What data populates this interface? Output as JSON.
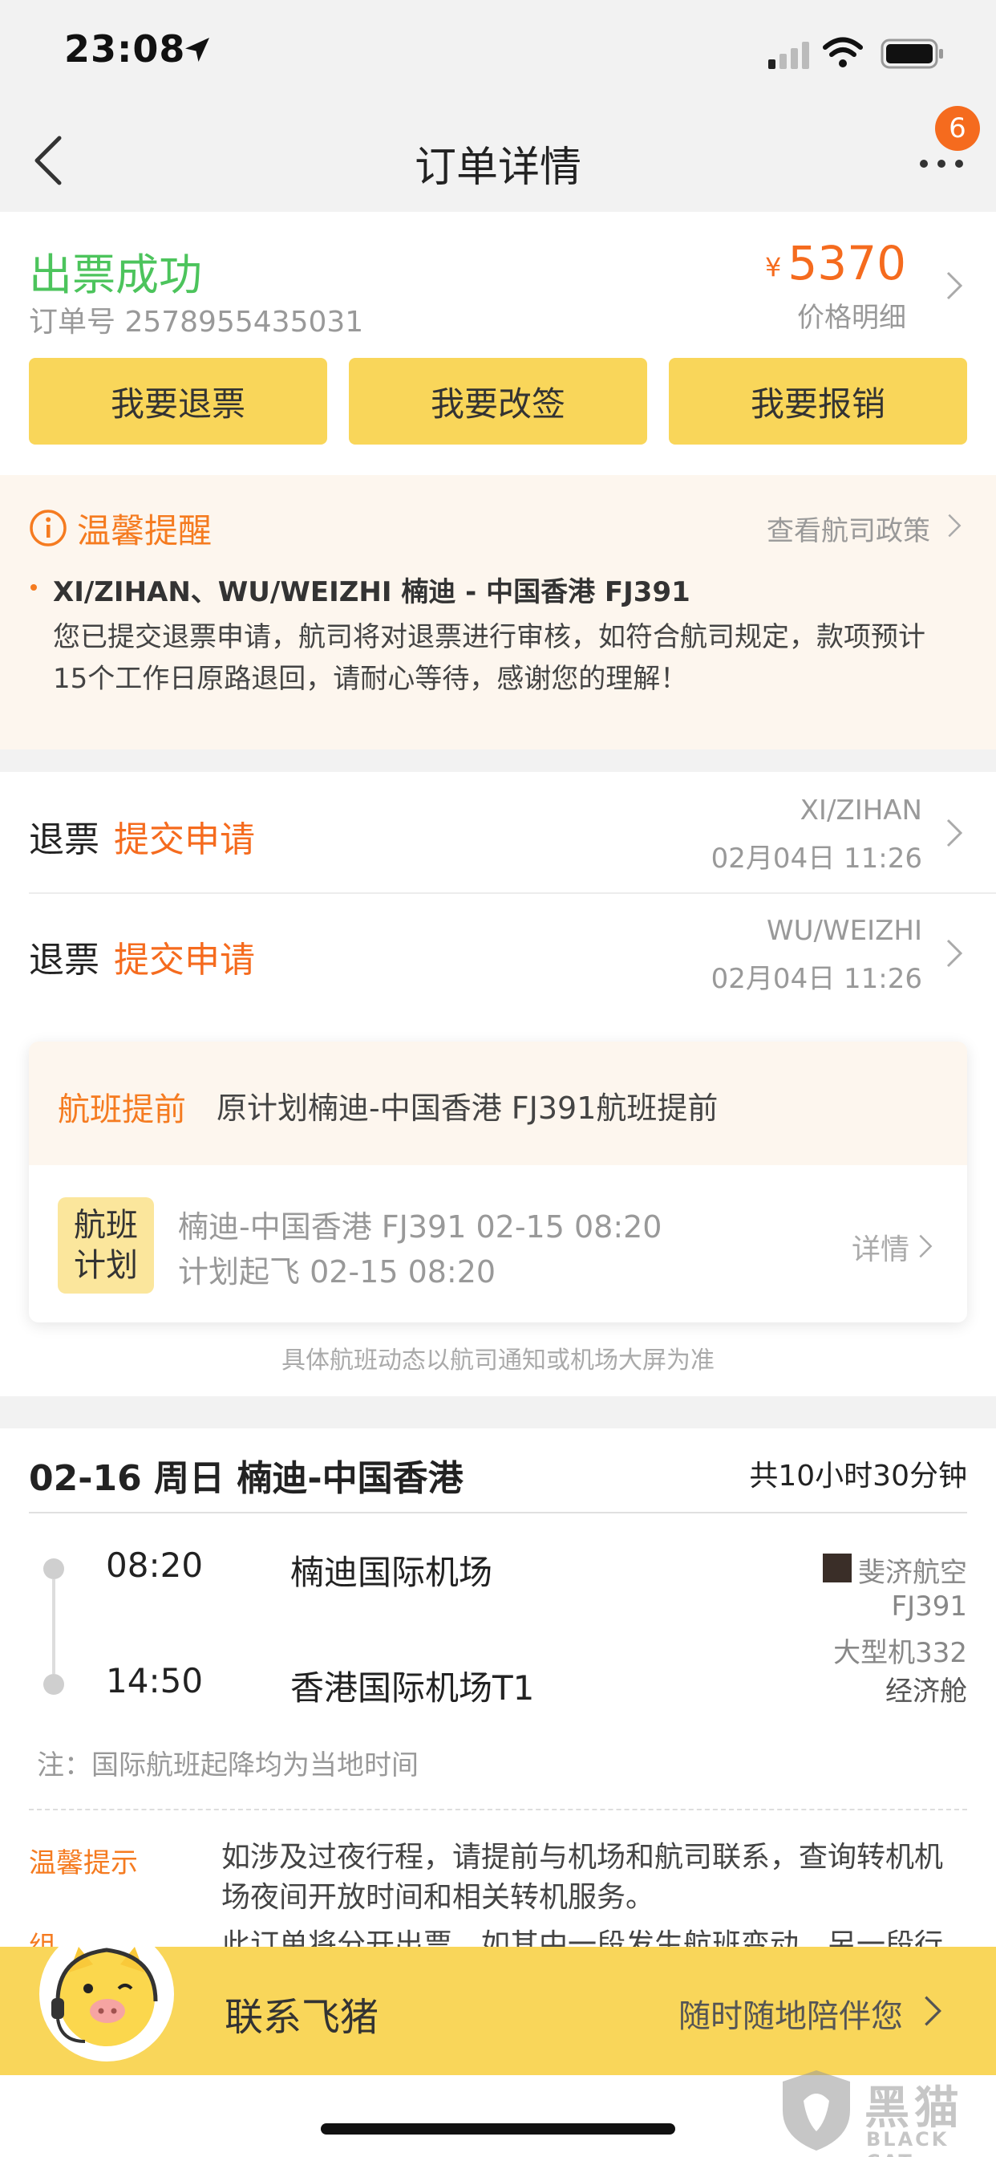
{
  "status_bar": {
    "time": "23:08"
  },
  "nav": {
    "title": "订单详情",
    "badge_count": "6"
  },
  "order": {
    "status": "出票成功",
    "order_no": "订单号 2578955435031",
    "currency": "¥",
    "price": "5370",
    "price_detail": "价格明细",
    "buttons": [
      "我要退票",
      "我要改签",
      "我要报销"
    ]
  },
  "notice": {
    "title": "温馨提醒",
    "policy_link": "查看航司政策",
    "route": "XI/ZIHAN、WU/WEIZHI 楠迪 - 中国香港 FJ391",
    "message": "您已提交退票申请，航司将对退票进行审核，如符合航司规定，款项预计15个工作日原路退回，请耐心等待，感谢您的理解！"
  },
  "refunds": [
    {
      "type": "退票",
      "status": "提交申请",
      "name": "XI/ZIHAN",
      "time": "02月04日 11:26"
    },
    {
      "type": "退票",
      "status": "提交申请",
      "name": "WU/WEIZHI",
      "time": "02月04日 11:26"
    }
  ],
  "flight_change": {
    "label": "航班提前",
    "desc": "原计划楠迪-中国香港 FJ391航班提前",
    "plan_tag": [
      "航班",
      "计划"
    ],
    "line1": "楠迪-中国香港 FJ391 02-15 08:20",
    "line2": "计划起飞 02-15 08:20",
    "detail": "详情",
    "footnote": "具体航班动态以航司通知或机场大屏为准"
  },
  "trip": {
    "date_route": "02-16 周日 楠迪-中国香港",
    "duration": "共10小时30分钟",
    "dep_time": "08:20",
    "dep_airport": "楠迪国际机场",
    "arr_time": "14:50",
    "arr_airport": "香港国际机场T1",
    "airline": "斐济航空",
    "flight_no": "FJ391",
    "aircraft": "大型机332",
    "cabin": "经济舱",
    "note": "注：国际航班起降均为当地时间",
    "tip_label": "温馨提示",
    "tip_text": "如涉及过夜行程，请提前与机场和航司联系，查询转机机场夜间开放时间和相关转机服务。",
    "tip2_label": "组",
    "tip2_text": "此订单将分开出票，如其中一段发生航班变动，另一段行"
  },
  "contact": {
    "label": "联系飞猪",
    "slogan": "随时随地陪伴您"
  },
  "watermark": {
    "cn": "黑猫",
    "en": "BLACK CAT"
  }
}
